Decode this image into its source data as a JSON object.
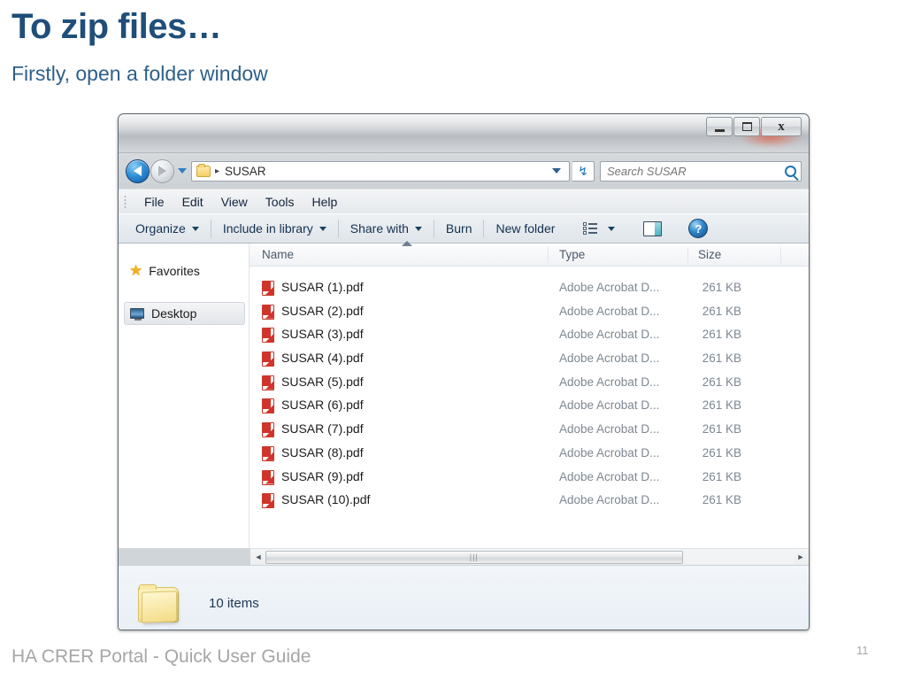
{
  "slide": {
    "title": "To zip files…",
    "subtitle": "Firstly, open a folder window",
    "footer": "HA CRER Portal - Quick User Guide",
    "page_number": "11",
    "title_color": "#1F4E79",
    "subtitle_color": "#2E5F8A"
  },
  "window": {
    "caption": {
      "minimize": "Minimize",
      "maximize": "Maximize",
      "close": "Close",
      "close_glyph": "x"
    },
    "address": {
      "back_tooltip": "Back",
      "forward_tooltip": "Forward",
      "crumb_separator": "▸",
      "path": "SUSAR",
      "refresh_glyph": "↯"
    },
    "search": {
      "placeholder": "Search SUSAR",
      "value": ""
    },
    "menubar": [
      "File",
      "Edit",
      "View",
      "Tools",
      "Help"
    ],
    "commandbar": {
      "organize": "Organize",
      "include_in_library": "Include in library",
      "share_with": "Share with",
      "burn": "Burn",
      "new_folder": "New folder"
    },
    "nav_pane": {
      "favorites": "Favorites",
      "desktop": "Desktop"
    },
    "columns": [
      "Name",
      "Type",
      "Size"
    ],
    "files": [
      {
        "name": "SUSAR (1).pdf",
        "type": "Adobe Acrobat D...",
        "size": "261 KB"
      },
      {
        "name": "SUSAR (2).pdf",
        "type": "Adobe Acrobat D...",
        "size": "261 KB"
      },
      {
        "name": "SUSAR (3).pdf",
        "type": "Adobe Acrobat D...",
        "size": "261 KB"
      },
      {
        "name": "SUSAR (4).pdf",
        "type": "Adobe Acrobat D...",
        "size": "261 KB"
      },
      {
        "name": "SUSAR (5).pdf",
        "type": "Adobe Acrobat D...",
        "size": "261 KB"
      },
      {
        "name": "SUSAR (6).pdf",
        "type": "Adobe Acrobat D...",
        "size": "261 KB"
      },
      {
        "name": "SUSAR (7).pdf",
        "type": "Adobe Acrobat D...",
        "size": "261 KB"
      },
      {
        "name": "SUSAR (8).pdf",
        "type": "Adobe Acrobat D...",
        "size": "261 KB"
      },
      {
        "name": "SUSAR (9).pdf",
        "type": "Adobe Acrobat D...",
        "size": "261 KB"
      },
      {
        "name": "SUSAR (10).pdf",
        "type": "Adobe Acrobat D...",
        "size": "261 KB"
      }
    ],
    "scrollbar": {
      "left_glyph": "◄",
      "right_glyph": "►",
      "thumb_grip": "|||"
    },
    "status": {
      "item_count": "10 items"
    },
    "help_glyph": "?"
  }
}
